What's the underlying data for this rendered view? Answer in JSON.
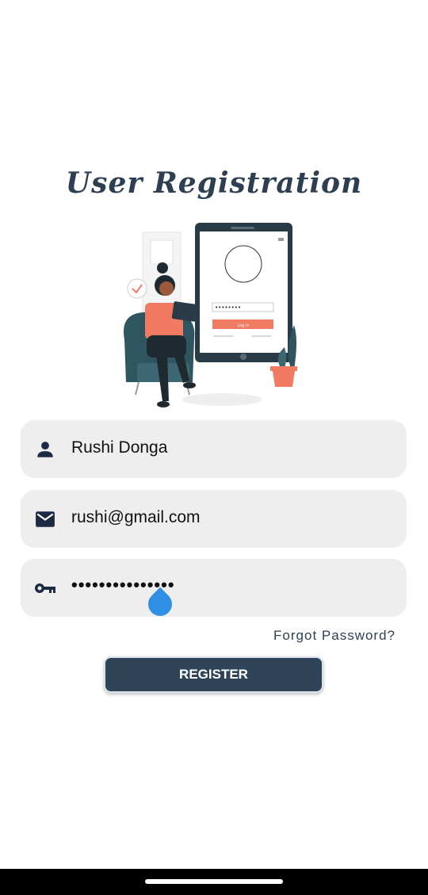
{
  "title": "User Registration",
  "illustration": {
    "password_mask": "••••••••",
    "login_button": "Log in"
  },
  "fields": {
    "name": {
      "icon": "person-icon",
      "value": "Rushi Donga"
    },
    "email": {
      "icon": "mail-icon",
      "value": "rushi@gmail.com"
    },
    "password": {
      "icon": "key-icon",
      "value": "•••••••••••••••"
    }
  },
  "forgot_password": "Forgot Password?",
  "register_button": "REGISTER",
  "colors": {
    "primary": "#2f4459",
    "field_bg": "#eeeeee",
    "accent_coral": "#f07a62",
    "cursor_blue": "#2f8fe3"
  }
}
